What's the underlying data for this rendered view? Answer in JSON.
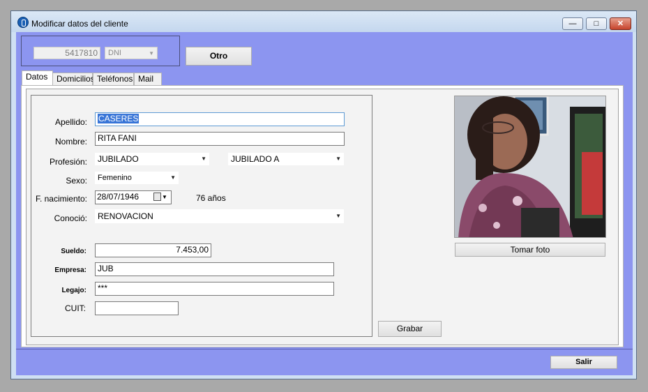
{
  "window": {
    "title": "Modificar datos del cliente"
  },
  "titlebar_buttons": {
    "minimize": "—",
    "maximize": "□",
    "close": "✕"
  },
  "header": {
    "document_number": "5417810",
    "document_type": "DNI",
    "otro_label": "Otro"
  },
  "tabs": [
    {
      "label": "Datos"
    },
    {
      "label": "Domicilios"
    },
    {
      "label": "Teléfonos"
    },
    {
      "label": "Mail"
    }
  ],
  "form": {
    "apellido_label": "Apellido:",
    "apellido_value": "CASERES",
    "nombre_label": "Nombre:",
    "nombre_value": "RITA FANI",
    "profesion_label": "Profesión:",
    "profesion_value": "JUBILADO",
    "profesion_sub_value": "JUBILADO A",
    "sexo_label": "Sexo:",
    "sexo_value": "Femenino",
    "nacimiento_label": "F. nacimiento:",
    "nacimiento_value": "28/07/1946",
    "edad_text": "76 años",
    "conocio_label": "Conoció:",
    "conocio_value": "RENOVACION",
    "sueldo_label": "Sueldo:",
    "sueldo_value": "7.453,00",
    "empresa_label": "Empresa:",
    "empresa_value": "JUB",
    "legajo_label": "Legajo:",
    "legajo_value": "***",
    "cuit_label": "CUIT:",
    "cuit_value": ""
  },
  "photo": {
    "take_photo_label": "Tomar foto"
  },
  "actions": {
    "grabar_label": "Grabar",
    "salir_label": "Salir"
  },
  "icons": {
    "app": "app-icon",
    "dropdown": "chevron-down-icon",
    "calendar": "calendar-icon"
  },
  "colors": {
    "client_area": "#8c95f0",
    "selection": "#3875d7"
  }
}
